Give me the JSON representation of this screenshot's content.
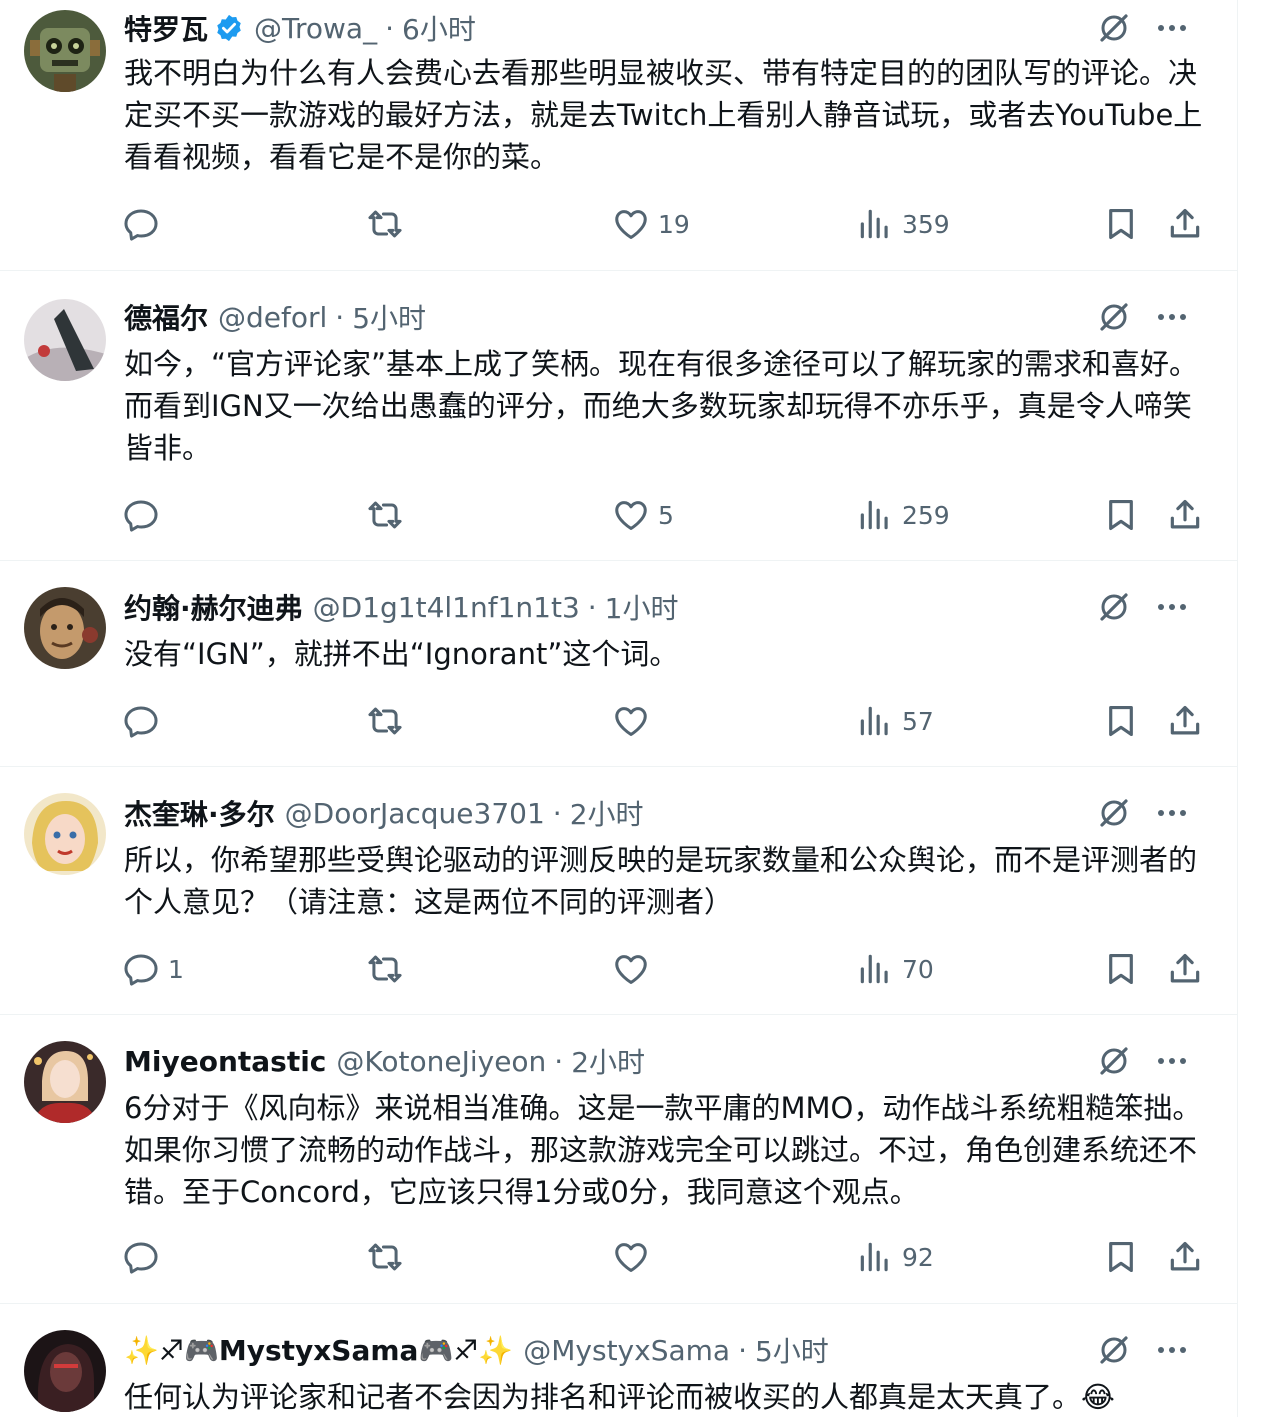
{
  "tweets": [
    {
      "name": "特罗瓦",
      "verified": true,
      "handle": "@Trowa_",
      "time": "6小时",
      "text": "我不明白为什么有人会费心去看那些明显被收买、带有特定目的的团队写的评论。决定买不买一款游戏的最好方法，就是去Twitch上看别人静音试玩，或者去YouTube上看看视频，看看它是不是你的菜。",
      "replies": "",
      "retweets": "",
      "likes": "19",
      "views": "359",
      "avatar_color": "#5a6b4a"
    },
    {
      "name": "德福尔",
      "verified": false,
      "handle": "@deforl",
      "time": "5小时",
      "text": "如今，“官方评论家”基本上成了笑柄。现在有很多途径可以了解玩家的需求和喜好。而看到IGN又一次给出愚蠢的评分，而绝大多数玩家却玩得不亦乐乎，真是令人啼笑皆非。",
      "replies": "",
      "retweets": "",
      "likes": "5",
      "views": "259",
      "avatar_color": "#c9c4c8"
    },
    {
      "name": "约翰·赫尔迪弗",
      "verified": false,
      "handle": "@D1g1t4l1nf1n1t3",
      "time": "1小时",
      "text": "没有“IGN”，就拼不出“Ignorant”这个词。",
      "replies": "",
      "retweets": "",
      "likes": "",
      "views": "57",
      "avatar_color": "#6b5a44"
    },
    {
      "name": "杰奎琳·多尔",
      "verified": false,
      "handle": "@DoorJacque3701",
      "time": "2小时",
      "text": "所以，你希望那些受舆论驱动的评测反映的是玩家数量和公众舆论，而不是评测者的个人意见？（请注意：这是两位不同的评测者）",
      "replies": "1",
      "retweets": "",
      "likes": "",
      "views": "70",
      "avatar_color": "#e8c46a"
    },
    {
      "name": "Miyeontastic",
      "verified": false,
      "handle": "@KotoneJiyeon",
      "time": "2小时",
      "text": "6分对于《风向标》来说相当准确。这是一款平庸的MMO，动作战斗系统粗糙笨拙。如果你习惯了流畅的动作战斗，那这款游戏完全可以跳过。不过，角色创建系统还不错。至于Concord，它应该只得1分或0分，我同意这个观点。",
      "replies": "",
      "retweets": "",
      "likes": "",
      "views": "92",
      "avatar_color": "#b02a2a"
    },
    {
      "name": "✨♐🎮MystyxSama🎮♐✨",
      "verified": false,
      "handle": "@MystyxSama",
      "time": "5小时",
      "text": "任何认为评论家和记者不会因为排名和评论而被收买的人都真是太天真了。😂",
      "replies": "",
      "retweets": "",
      "likes": "",
      "views": "",
      "avatar_color": "#3a1f22"
    }
  ],
  "icons": {
    "reply": "reply-icon",
    "retweet": "retweet-icon",
    "like": "heart-icon",
    "views": "views-icon",
    "bookmark": "bookmark-icon",
    "share": "share-icon",
    "grok": "grok-icon",
    "more": "more-icon"
  },
  "colors": {
    "verified": "#1d9bf0",
    "muted": "#536471",
    "divider": "#eff3f4"
  }
}
